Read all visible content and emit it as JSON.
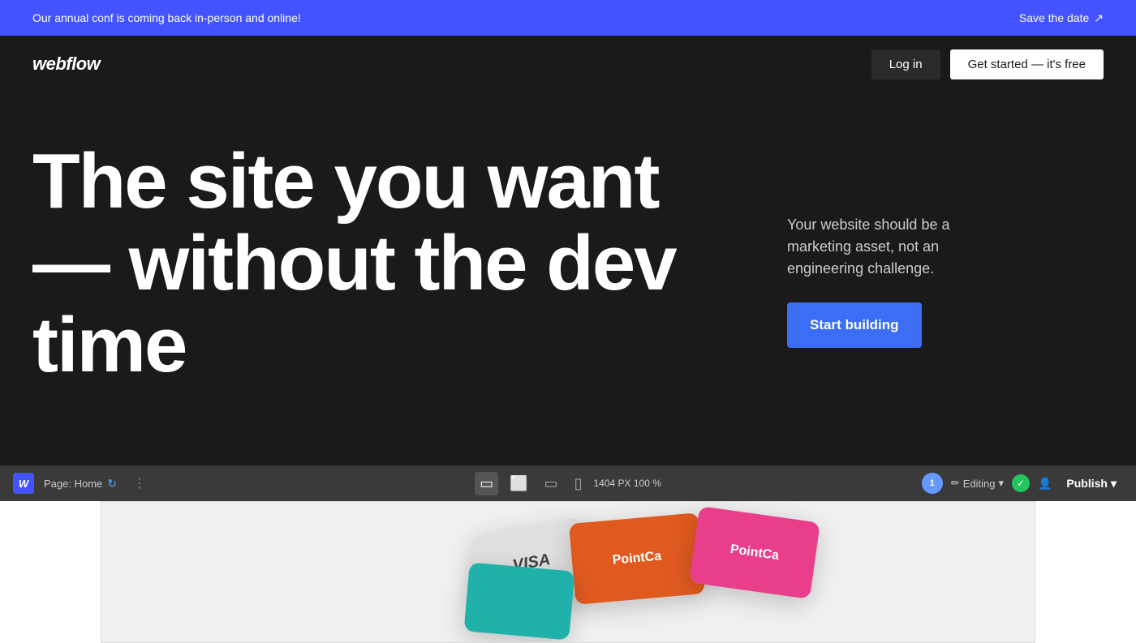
{
  "announcement": {
    "message": "Our annual conf is coming back in-person and online!",
    "cta_label": "Save the date",
    "cta_arrow": "↗"
  },
  "navbar": {
    "logo": "webflow",
    "login_label": "Log in",
    "get_started_label": "Get started — it's free"
  },
  "hero": {
    "headline": "The site you want — without the dev time",
    "subtext": "Your website should be a marketing asset, not an engineering challenge.",
    "cta_label": "Start building"
  },
  "editor": {
    "w_icon": "W",
    "page_label": "Page: Home",
    "dots": "⋮",
    "px_info": "1404 PX   100 %",
    "editing_label": "Editing",
    "publish_label": "Publish",
    "publish_chevron": "▾",
    "check": "✓",
    "avatar_count": "1"
  },
  "preview": {
    "cards": [
      {
        "text": "VISA",
        "style": "visa"
      },
      {
        "text": "PointCa",
        "style": "orange"
      },
      {
        "text": "PointCa",
        "style": "pink"
      },
      {
        "text": "",
        "style": "teal"
      }
    ]
  }
}
